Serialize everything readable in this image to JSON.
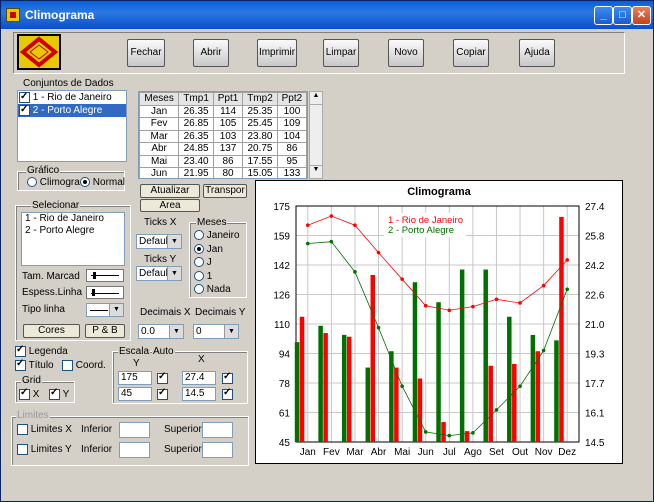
{
  "window": {
    "title": "Climograma"
  },
  "toolbar": {
    "buttons": [
      "Fechar",
      "Abrir",
      "Imprimir",
      "Limpar",
      "Novo",
      "Copiar",
      "Ajuda"
    ]
  },
  "datasets": {
    "label": "Conjuntos de Dados",
    "items": [
      "1 - Rio de Janeiro",
      "2 - Porto Alegre"
    ]
  },
  "table": {
    "headers": [
      "Meses",
      "Tmp1",
      "Ppt1",
      "Tmp2",
      "Ppt2"
    ],
    "rows": [
      [
        "Jan",
        "26.35",
        "114",
        "25.35",
        "100"
      ],
      [
        "Fev",
        "26.85",
        "105",
        "25.45",
        "109"
      ],
      [
        "Mar",
        "26.35",
        "103",
        "23.80",
        "104"
      ],
      [
        "Abr",
        "24.85",
        "137",
        "20.75",
        "86"
      ],
      [
        "Mai",
        "23.40",
        "86",
        "17.55",
        "95"
      ],
      [
        "Jun",
        "21.95",
        "80",
        "15.05",
        "133"
      ]
    ]
  },
  "grafico": {
    "label": "Gráfico",
    "options": [
      "Climogra",
      "Normal"
    ],
    "selected": "Normal"
  },
  "actions": {
    "atualizar": "Atualizar",
    "transpor": "Transpor",
    "area": "Area"
  },
  "selecionar": {
    "label": "Selecionar",
    "items": [
      "1 - Rio de Janeiro",
      "2 - Porto Alegre"
    ]
  },
  "ticks": {
    "x_label": "Ticks X",
    "x_value": "Default",
    "y_label": "Ticks Y",
    "y_value": "Default"
  },
  "meses": {
    "label": "Meses",
    "options": [
      "Janeiro",
      "Jan",
      "J",
      "1",
      "Nada"
    ],
    "selected": "Jan"
  },
  "style": {
    "tam_marcad": "Tam. Marcad",
    "espess_linha": "Espess.Linha",
    "tipo_linha": "Tipo linha",
    "cores": "Cores",
    "pb": "P & B"
  },
  "decimais": {
    "x_label": "Decimais X",
    "x_value": "0.0",
    "y_label": "Decimais Y",
    "y_value": "0"
  },
  "checks": {
    "legenda": "Legenda",
    "titulo": "Título",
    "coord": "Coord.",
    "grid": "Grid",
    "x": "X",
    "y": "Y"
  },
  "escala": {
    "label": "Escala",
    "auto": "Auto",
    "y": "Y",
    "x": "X",
    "y_max": "175",
    "y_min": "45",
    "x_max": "27.4",
    "x_min": "14.5"
  },
  "limites": {
    "label": "Limites",
    "x": "Limites X",
    "y": "Limites Y",
    "inferior": "Inferior",
    "superior": "Superior"
  },
  "chart_data": {
    "type": "bar",
    "title": "Climograma",
    "categories": [
      "Jan",
      "Fev",
      "Mar",
      "Abr",
      "Mai",
      "Jun",
      "Jul",
      "Ago",
      "Set",
      "Out",
      "Nov",
      "Dez"
    ],
    "y_left": {
      "ylim": [
        45,
        175
      ],
      "ticks": [
        "175",
        "159",
        "142",
        "126",
        "110",
        "94",
        "78",
        "61",
        "45"
      ]
    },
    "y_right": {
      "ylim": [
        14.5,
        27.4
      ],
      "ticks": [
        "27.4",
        "25.8",
        "24.2",
        "22.6",
        "21.0",
        "19.3",
        "17.7",
        "16.1",
        "14.5"
      ]
    },
    "bars": [
      {
        "series": "1 - Rio de Janeiro",
        "color": "#ff0000",
        "values": [
          114,
          105,
          103,
          137,
          86,
          80,
          56,
          51,
          87,
          88,
          95,
          169
        ]
      },
      {
        "series": "2 - Porto Alegre",
        "color": "#007000",
        "values": [
          100,
          109,
          104,
          86,
          95,
          133,
          122,
          140,
          140,
          114,
          104,
          101
        ]
      }
    ],
    "lines": [
      {
        "series": "1 - Rio de Janeiro",
        "color": "#ff0000",
        "values": [
          26.35,
          26.85,
          26.35,
          24.85,
          23.4,
          21.95,
          21.7,
          21.9,
          22.3,
          22.1,
          23.05,
          24.45
        ]
      },
      {
        "series": "2 - Porto Alegre",
        "color": "#007000",
        "values": [
          25.35,
          25.45,
          23.8,
          20.75,
          17.55,
          15.05,
          14.85,
          15.0,
          16.25,
          17.55,
          19.5,
          22.85
        ]
      }
    ],
    "legend": [
      "1 - Rio de Janeiro",
      "2 - Porto Alegre"
    ],
    "legend_position": "top-center"
  }
}
